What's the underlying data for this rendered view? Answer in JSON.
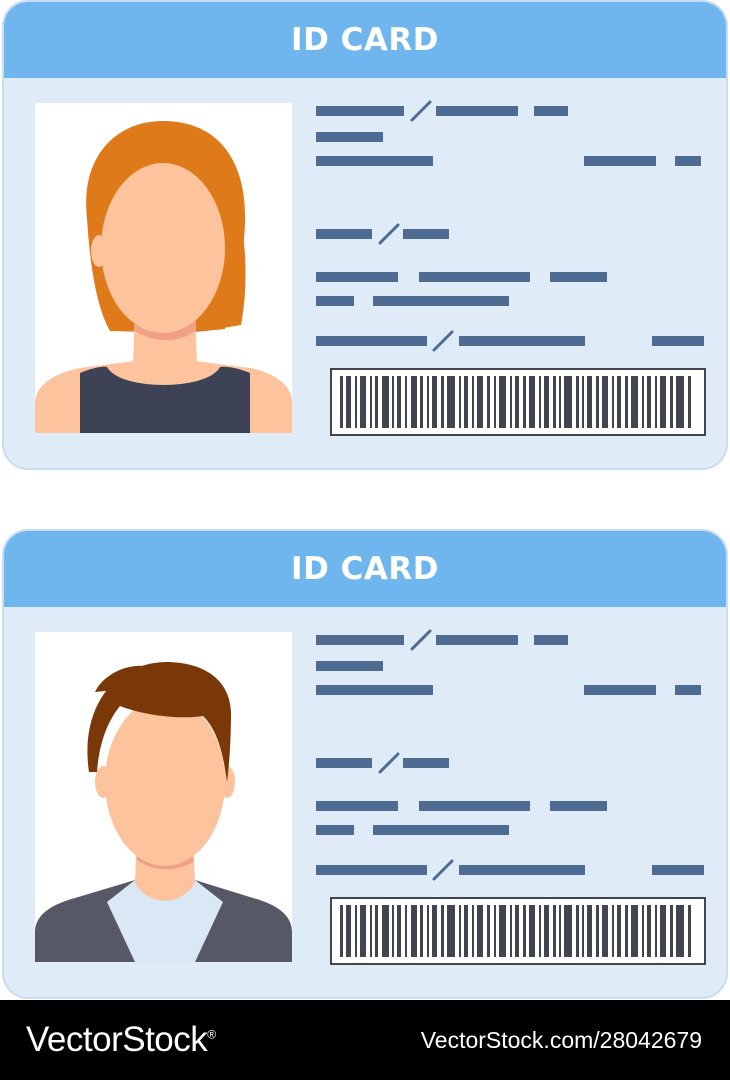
{
  "cards": [
    {
      "title": "ID CARD",
      "portrait": "female-avatar-icon",
      "colors": {
        "hair": "#de7a19",
        "skin": "#fcc39c",
        "shadow": "#f1a086",
        "top": "#3d4254"
      }
    },
    {
      "title": "ID CARD",
      "portrait": "male-avatar-icon",
      "colors": {
        "hair": "#7a3808",
        "skin": "#fcc39c",
        "shadow": "#f1a086",
        "jacket": "#565965",
        "shirt": "#dae8f5"
      }
    }
  ],
  "colors": {
    "header": "#70b6ee",
    "card_body": "#dfebf7",
    "text_placeholder": "#4d6b93",
    "barcode": "#40454f",
    "footer": "#000000"
  },
  "footer": {
    "brand": "VectorStock",
    "registered_mark": "®",
    "stock_id": "VectorStock.com/28042679"
  }
}
